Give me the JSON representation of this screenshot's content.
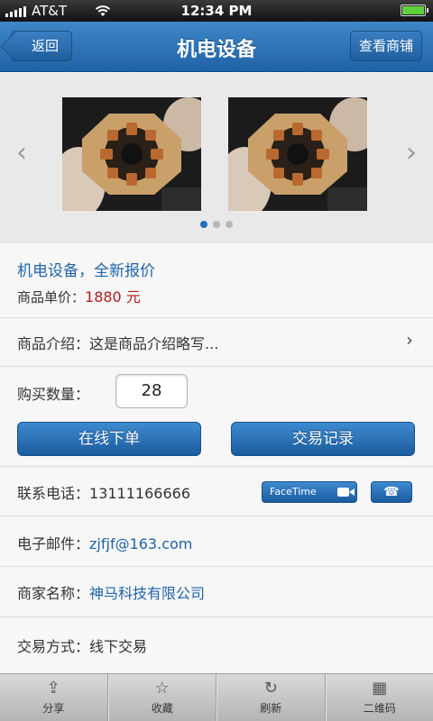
{
  "status_bar": {
    "carrier": "AT&T",
    "time": "12:34 PM"
  },
  "nav": {
    "back_label": "返回",
    "title": "机电设备",
    "shop_label": "查看商铺"
  },
  "gallery": {
    "page_count": 3,
    "active_index": 0,
    "left_icon": "chevron-left-icon",
    "right_icon": "chevron-right-icon"
  },
  "product": {
    "title": "机电设备，全新报价",
    "price_label": "商品单价：",
    "price_value": "1880 元",
    "intro_label": "商品介绍：",
    "intro_value": "这是商品介绍略写..."
  },
  "quantity": {
    "label": "购买数量：",
    "value": "28"
  },
  "actions": {
    "order_label": "在线下单",
    "records_label": "交易记录"
  },
  "contact": {
    "phone_label": "联系电话：",
    "phone_value": "13111166666",
    "facetime_label": "FaceTime",
    "email_label": "电子邮件：",
    "email_value": "zjfjf@163.com",
    "merchant_label": "商家名称：",
    "merchant_value": "神马科技有限公司",
    "trade_label": "交易方式：",
    "trade_value": "线下交易"
  },
  "tabbar": [
    {
      "label": "分享",
      "icon": "share-icon"
    },
    {
      "label": "收藏",
      "icon": "star-icon"
    },
    {
      "label": "刷新",
      "icon": "refresh-icon"
    },
    {
      "label": "二维码",
      "icon": "qrcode-icon"
    }
  ],
  "colors": {
    "brand_blue": "#1f63a6",
    "link_blue": "#1e64a8",
    "price_red": "#b01c1c"
  }
}
